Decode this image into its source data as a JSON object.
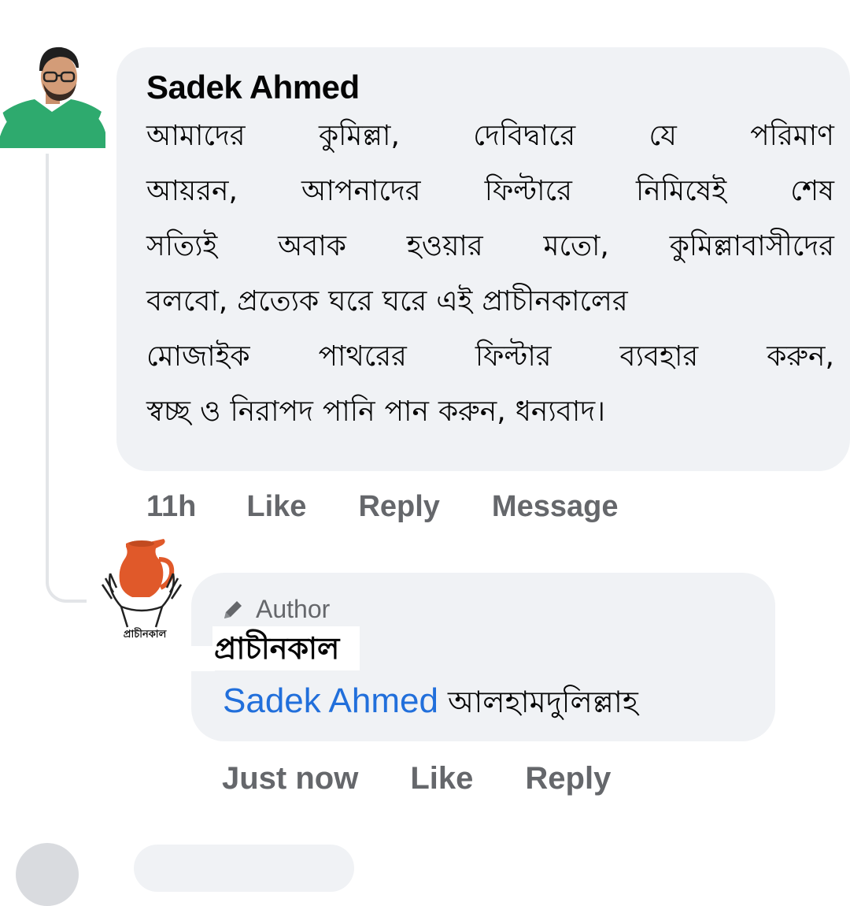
{
  "colors": {
    "bubble_bg": "#f0f2f5",
    "text": "#050505",
    "muted": "#65676b",
    "link": "#216fdb",
    "thread_line": "#e3e5e8",
    "avatar_shirt": "#2eaa6e",
    "jug": "#e0592a"
  },
  "comment": {
    "author": "Sadek Ahmed",
    "avatar_icon": "user-avatar-photo",
    "lines": [
      [
        "আমাদের",
        "কুমিল্লা,",
        "দেবিদ্বারে",
        "যে",
        "পরিমাণ"
      ],
      [
        "আয়রন,",
        "আপনাদের",
        "ফিল্টারে",
        "নিমিষেই",
        "শেষ"
      ],
      [
        "সত্যিই",
        "অবাক",
        "হওয়ার",
        "মতো,",
        "কুমিল্লাবাসীদের"
      ],
      [
        "বলবো,",
        "প্রত্যেক",
        "ঘরে",
        "ঘরে",
        "এই",
        "প্রাচীনকালের"
      ],
      [
        "মোজাইক",
        "পাথরের",
        "ফিল্টার",
        "ব্যবহার",
        "করুন,"
      ],
      [
        "স্বচ্ছ",
        "ও",
        "নিরাপদ",
        "পানি",
        "পান",
        "করুন,",
        "ধন্যবাদ।"
      ]
    ],
    "actions": {
      "timestamp": "11h",
      "like": "Like",
      "reply": "Reply",
      "message": "Message"
    }
  },
  "reply": {
    "badge": "Author",
    "badge_icon": "pencil-icon",
    "author": "প্রাচীনকাল",
    "avatar_icon": "clay-jug-hands-logo",
    "avatar_label": "প্রাচীনকাল",
    "mention": "Sadek Ahmed",
    "text": "আলহামদুলিল্লাহ",
    "actions": {
      "timestamp": "Just now",
      "like": "Like",
      "reply": "Reply"
    }
  }
}
